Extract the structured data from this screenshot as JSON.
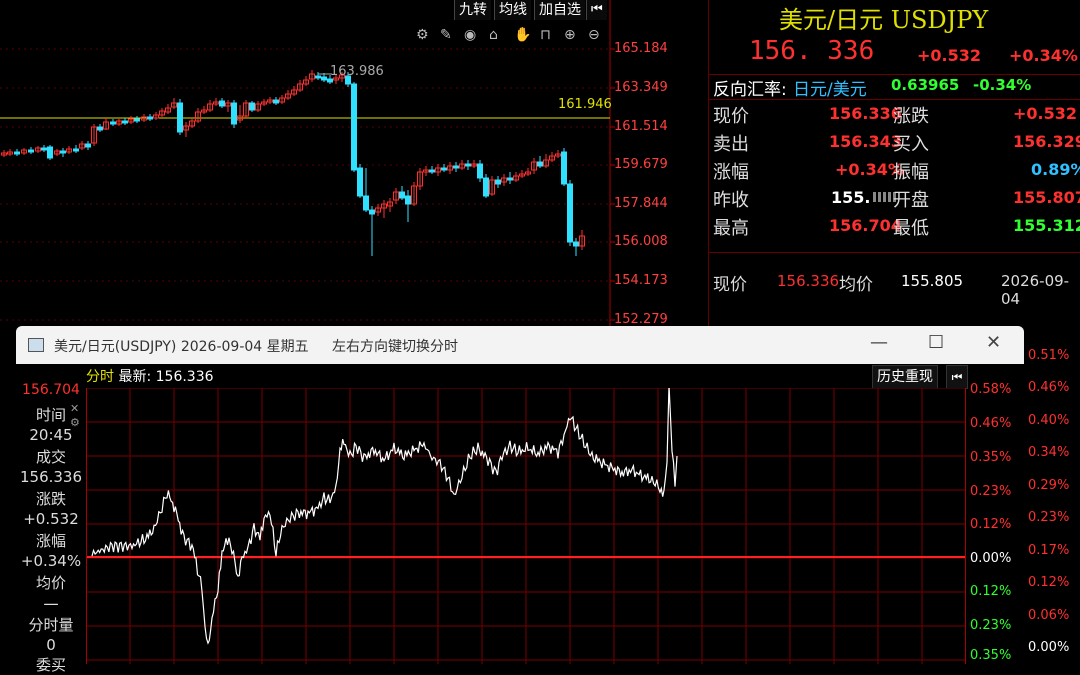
{
  "toolbar": {
    "btn1": "九转",
    "btn2": "均线",
    "btn3": "加自选",
    "back_icon": "skip-back-icon"
  },
  "kline": {
    "axis_labels": [
      "165.184",
      "163.349",
      "161.514",
      "159.679",
      "157.844",
      "156.008",
      "154.173",
      "152.279"
    ],
    "high_label": "163.986",
    "hline_label": "161.946",
    "colors": {
      "up": "#ff3030",
      "down": "#30e0ff",
      "hline": "#e0e000"
    }
  },
  "quote": {
    "title": "美元/日元 USDJPY",
    "price": "156. 336",
    "change": "+0.532",
    "change_pct": "+0.34%",
    "reverse_label": "反向汇率:",
    "reverse_pair": "日元/美元",
    "reverse_value": "0.63965",
    "reverse_pct": "-0.34%",
    "rows": [
      {
        "l1": "现价",
        "v1": "156.336",
        "l2": "涨跌",
        "v2": "+0.532"
      },
      {
        "l1": "卖出",
        "v1": "156.343",
        "l2": "买入",
        "v2": "156.329"
      },
      {
        "l1": "涨幅",
        "v1": "+0.34%",
        "l2": "振幅",
        "v2": "0.89%"
      },
      {
        "l1": "昨收",
        "v1": "155.",
        "l2": "开盘",
        "v2": "155.807"
      },
      {
        "l1": "最高",
        "v1": "156.704",
        "l2": "最低",
        "v2": "155.312"
      }
    ],
    "bottom": {
      "l1": "现价",
      "v1": "156.336",
      "l2": "均价",
      "v2": "155.805",
      "date": "2026-09-04"
    }
  },
  "popup": {
    "title": "美元/日元(USDJPY) 2026-09-04 星期五",
    "hint": "左右方向键切换分时",
    "header": {
      "label1": "分时",
      "label2": "最新:",
      "value": "156.336"
    },
    "history_btn": "历史重现",
    "top_value": "156.704",
    "side": [
      {
        "k": "时间",
        "v": "20:45"
      },
      {
        "k": "成交",
        "v": "156.336"
      },
      {
        "k": "涨跌",
        "v": "+0.532"
      },
      {
        "k": "涨幅",
        "v": "+0.34%"
      },
      {
        "k": "均价",
        "v": "一"
      },
      {
        "k": "分时量",
        "v": "0"
      },
      {
        "k": "委买",
        "v": ""
      }
    ],
    "pct_labels": [
      "0.58%",
      "0.46%",
      "0.35%",
      "0.23%",
      "0.12%",
      "0.00%",
      "0.12%",
      "0.23%",
      "0.35%"
    ],
    "outer_pct_labels": [
      "0.51%",
      "0.46%",
      "0.40%",
      "0.34%",
      "0.29%",
      "0.23%",
      "0.17%",
      "0.12%",
      "0.06%",
      "0.00%"
    ]
  }
}
